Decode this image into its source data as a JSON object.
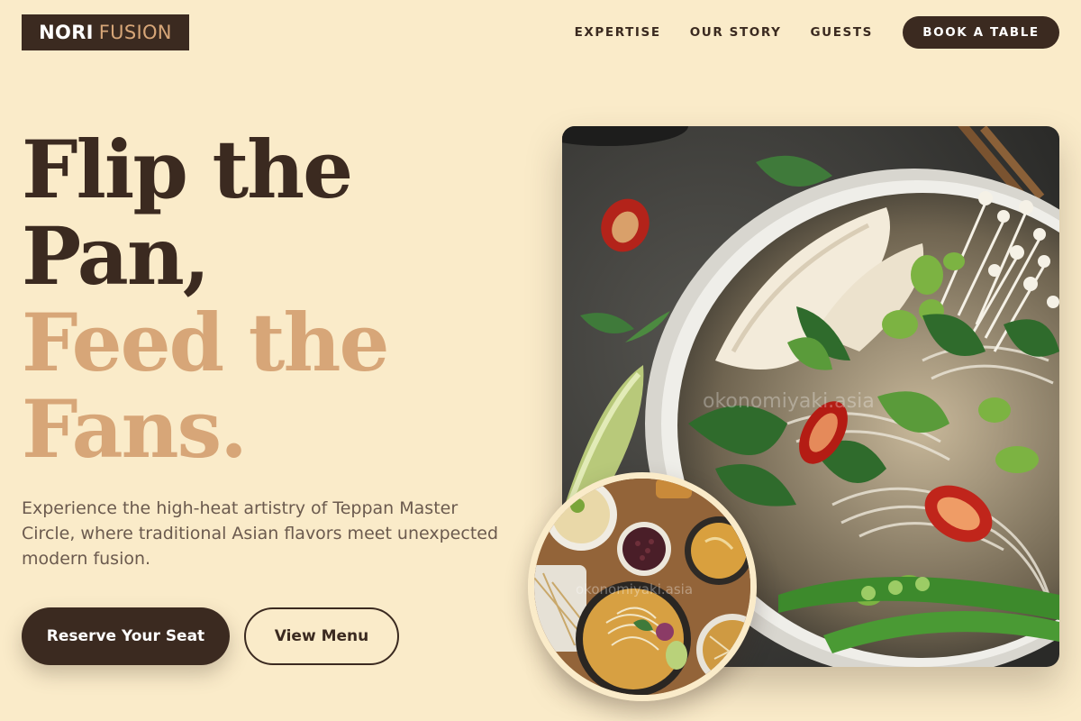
{
  "brand": {
    "name_bold": "NORI",
    "name_light": "FUSION"
  },
  "nav": {
    "links": [
      "EXPERTISE",
      "OUR STORY",
      "GUESTS"
    ],
    "cta": "BOOK A TABLE"
  },
  "hero": {
    "headline_dark": [
      "Flip the",
      "Pan,"
    ],
    "headline_light": [
      "Feed the",
      "Fans."
    ],
    "description": "Experience the high-heat artistry of Teppan Master Circle, where traditional Asian flavors meet unexpected modern fusion.",
    "primary_button": "Reserve Your Seat",
    "secondary_button": "View Menu",
    "image_watermark": "okonomiyaki.asia",
    "inset_watermark": "okonomiyaki.asia"
  },
  "colors": {
    "background": "#faebc9",
    "dark": "#3b2a20",
    "accent": "#d7a678"
  },
  "icons": {
    "hero_image": "noodle-soup-bowl-photo",
    "inset_image": "asian-dishes-spread-photo"
  }
}
